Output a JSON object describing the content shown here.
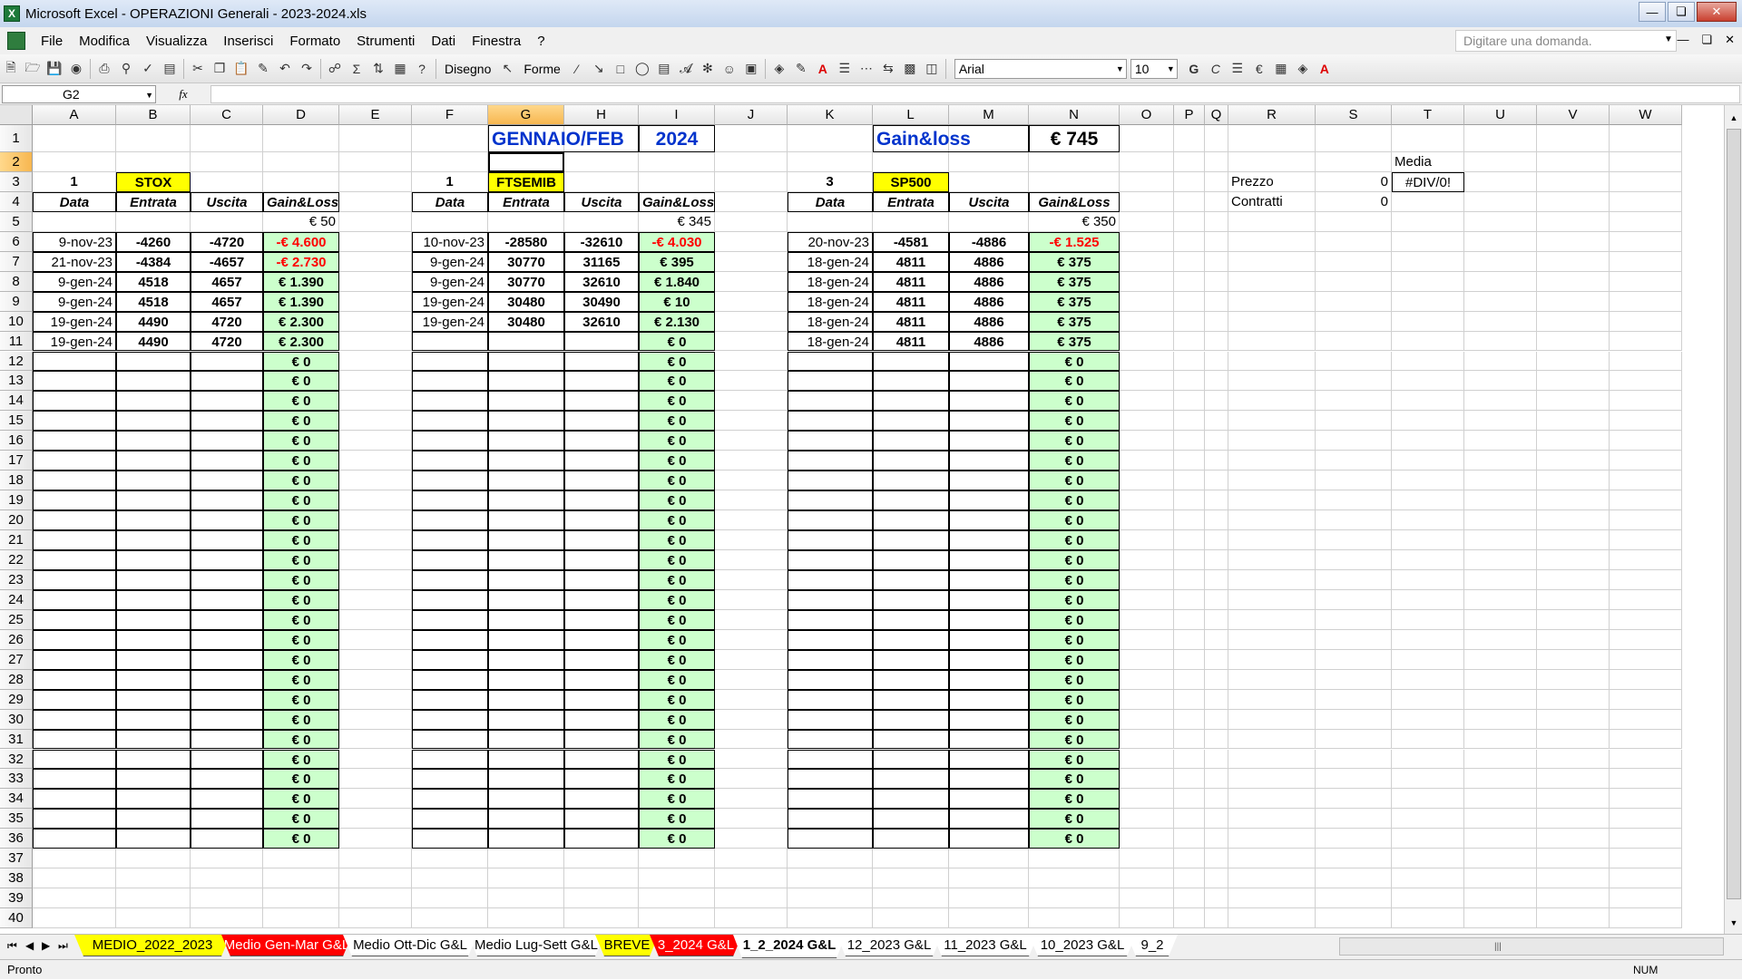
{
  "window": {
    "title": "Microsoft Excel - OPERAZIONI Generali - 2023-2024.xls"
  },
  "menu": {
    "items": [
      "File",
      "Modifica",
      "Visualizza",
      "Inserisci",
      "Formato",
      "Strumenti",
      "Dati",
      "Finestra",
      "?"
    ],
    "help_placeholder": "Digitare una domanda."
  },
  "toolbar": {
    "disegno_label": "Disegno",
    "forme_label": "Forme",
    "font_name": "Arial",
    "font_size": "10",
    "bold_label": "G",
    "italic_label": "C"
  },
  "formula_bar": {
    "name_box": "G2",
    "fx_label": "fx",
    "formula": ""
  },
  "columns": [
    "A",
    "B",
    "C",
    "D",
    "E",
    "F",
    "G",
    "H",
    "I",
    "J",
    "K",
    "L",
    "M",
    "N",
    "O",
    "P",
    "Q",
    "R",
    "S",
    "T",
    "U",
    "V",
    "W"
  ],
  "selected_column": "G",
  "selected_row": 2,
  "rows_visible": [
    1,
    2,
    3,
    4,
    5,
    6,
    7,
    8,
    9,
    10,
    11,
    12,
    13,
    14,
    15,
    16,
    17,
    18,
    19,
    20,
    21,
    22,
    23,
    24,
    25,
    26,
    27,
    28,
    29,
    30,
    31,
    32,
    33,
    34,
    35,
    36,
    37,
    38,
    39,
    40
  ],
  "header_cells": {
    "period": "GENNAIO/FEB",
    "year": "2024",
    "gainloss_label": "Gain&loss",
    "gainloss_total": "€ 745",
    "media_label": "Media",
    "prezzo_label": "Prezzo",
    "prezzo_value": "0",
    "media_value": "#DIV/0!",
    "contratti_label": "Contratti",
    "contratti_value": "0"
  },
  "blocks": [
    {
      "id": "stox",
      "contracts": "1",
      "instrument": "STOX",
      "headers": [
        "Data",
        "Entrata",
        "Uscita",
        "Gain&Loss"
      ],
      "total": "€ 50",
      "rows": [
        {
          "date": "9-nov-23",
          "entry": "-4260",
          "exit": "-4720",
          "gl": "-€ 4.600",
          "neg": true
        },
        {
          "date": "21-nov-23",
          "entry": "-4384",
          "exit": "-4657",
          "gl": "-€ 2.730",
          "neg": true
        },
        {
          "date": "9-gen-24",
          "entry": "4518",
          "exit": "4657",
          "gl": "€ 1.390",
          "neg": false
        },
        {
          "date": "9-gen-24",
          "entry": "4518",
          "exit": "4657",
          "gl": "€ 1.390",
          "neg": false
        },
        {
          "date": "19-gen-24",
          "entry": "4490",
          "exit": "4720",
          "gl": "€ 2.300",
          "neg": false
        },
        {
          "date": "19-gen-24",
          "entry": "4490",
          "exit": "4720",
          "gl": "€ 2.300",
          "neg": false
        }
      ]
    },
    {
      "id": "ftsemib",
      "contracts": "1",
      "instrument": "FTSEMIB",
      "headers": [
        "Data",
        "Entrata",
        "Uscita",
        "Gain&Loss"
      ],
      "total": "€ 345",
      "rows": [
        {
          "date": "10-nov-23",
          "entry": "-28580",
          "exit": "-32610",
          "gl": "-€ 4.030",
          "neg": true
        },
        {
          "date": "9-gen-24",
          "entry": "30770",
          "exit": "31165",
          "gl": "€ 395",
          "neg": false
        },
        {
          "date": "9-gen-24",
          "entry": "30770",
          "exit": "32610",
          "gl": "€ 1.840",
          "neg": false
        },
        {
          "date": "19-gen-24",
          "entry": "30480",
          "exit": "30490",
          "gl": "€ 10",
          "neg": false
        },
        {
          "date": "19-gen-24",
          "entry": "30480",
          "exit": "32610",
          "gl": "€ 2.130",
          "neg": false
        }
      ]
    },
    {
      "id": "sp500",
      "contracts": "3",
      "instrument": "SP500",
      "headers": [
        "Data",
        "Entrata",
        "Uscita",
        "Gain&Loss"
      ],
      "total": "€ 350",
      "rows": [
        {
          "date": "20-nov-23",
          "entry": "-4581",
          "exit": "-4886",
          "gl": "-€ 1.525",
          "neg": true
        },
        {
          "date": "18-gen-24",
          "entry": "4811",
          "exit": "4886",
          "gl": "€ 375",
          "neg": false
        },
        {
          "date": "18-gen-24",
          "entry": "4811",
          "exit": "4886",
          "gl": "€ 375",
          "neg": false
        },
        {
          "date": "18-gen-24",
          "entry": "4811",
          "exit": "4886",
          "gl": "€ 375",
          "neg": false
        },
        {
          "date": "18-gen-24",
          "entry": "4811",
          "exit": "4886",
          "gl": "€ 375",
          "neg": false
        },
        {
          "date": "18-gen-24",
          "entry": "4811",
          "exit": "4886",
          "gl": "€ 375",
          "neg": false
        }
      ]
    }
  ],
  "empty_gl_value": "€ 0",
  "sheet_tabs": [
    {
      "label": "MEDIO_2022_2023",
      "style": "yellow"
    },
    {
      "label": "Medio Gen-Mar G&L",
      "style": "red"
    },
    {
      "label": "Medio Ott-Dic G&L",
      "style": "plain"
    },
    {
      "label": "Medio Lug-Sett G&L",
      "style": "plain"
    },
    {
      "label": "BREVE",
      "style": "yellow"
    },
    {
      "label": "3_2024 G&L",
      "style": "red"
    },
    {
      "label": "1_2_2024 G&L",
      "style": "active"
    },
    {
      "label": "12_2023 G&L",
      "style": "plain"
    },
    {
      "label": "11_2023 G&L",
      "style": "plain"
    },
    {
      "label": "10_2023 G&L",
      "style": "plain"
    },
    {
      "label": "9_2",
      "style": "plain"
    }
  ],
  "status": {
    "mode": "Pronto",
    "num_lock": "NUM"
  },
  "colors": {
    "gain_fill": "#ccffcc",
    "instrument_fill": "#ffff00",
    "negative_text": "#ff0000",
    "title_text": "#0033cc",
    "selection_header": "#f7b750"
  }
}
